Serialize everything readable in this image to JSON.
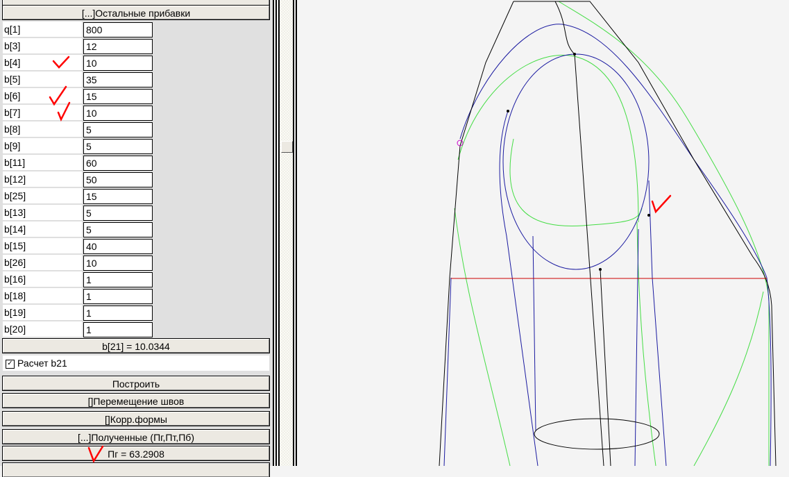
{
  "panel": {
    "section_title": "[...]Остальные прибавки",
    "params": [
      {
        "name": "q[1]",
        "value": "800"
      },
      {
        "name": "b[3]",
        "value": "12"
      },
      {
        "name": "b[4]",
        "value": "10"
      },
      {
        "name": "b[5]",
        "value": "35"
      },
      {
        "name": "b[6]",
        "value": "15"
      },
      {
        "name": "b[7]",
        "value": "10"
      },
      {
        "name": "b[8]",
        "value": "5"
      },
      {
        "name": "b[9]",
        "value": "5"
      },
      {
        "name": "b[11]",
        "value": "60"
      },
      {
        "name": "b[12]",
        "value": "50"
      },
      {
        "name": "b[25]",
        "value": "15"
      },
      {
        "name": "b[13]",
        "value": "5"
      },
      {
        "name": "b[14]",
        "value": "5"
      },
      {
        "name": "b[15]",
        "value": "40"
      },
      {
        "name": "b[26]",
        "value": "10"
      },
      {
        "name": "b[16]",
        "value": "1"
      },
      {
        "name": "b[18]",
        "value": "1"
      },
      {
        "name": "b[19]",
        "value": "1"
      },
      {
        "name": "b[20]",
        "value": "1"
      }
    ],
    "b21_result": "b[21]  = 10.0344",
    "b21_checkbox": {
      "label": "Расчет b21",
      "checked": true
    },
    "build_button": "Построить",
    "move_seams_button": "[]Перемещение швов",
    "shape_corr_button": "[]Корр.формы",
    "results_title": "[...]Полученные (Пг,Пт,Пб)",
    "pg_result": "Пг = 63.2908"
  },
  "colors": {
    "outline": "#000000",
    "pattern_blue": "#1a1aa0",
    "pattern_green": "#44dd44",
    "guide_red": "#cc0000",
    "marker": "#cc00cc",
    "annotation": "#ff0000"
  }
}
